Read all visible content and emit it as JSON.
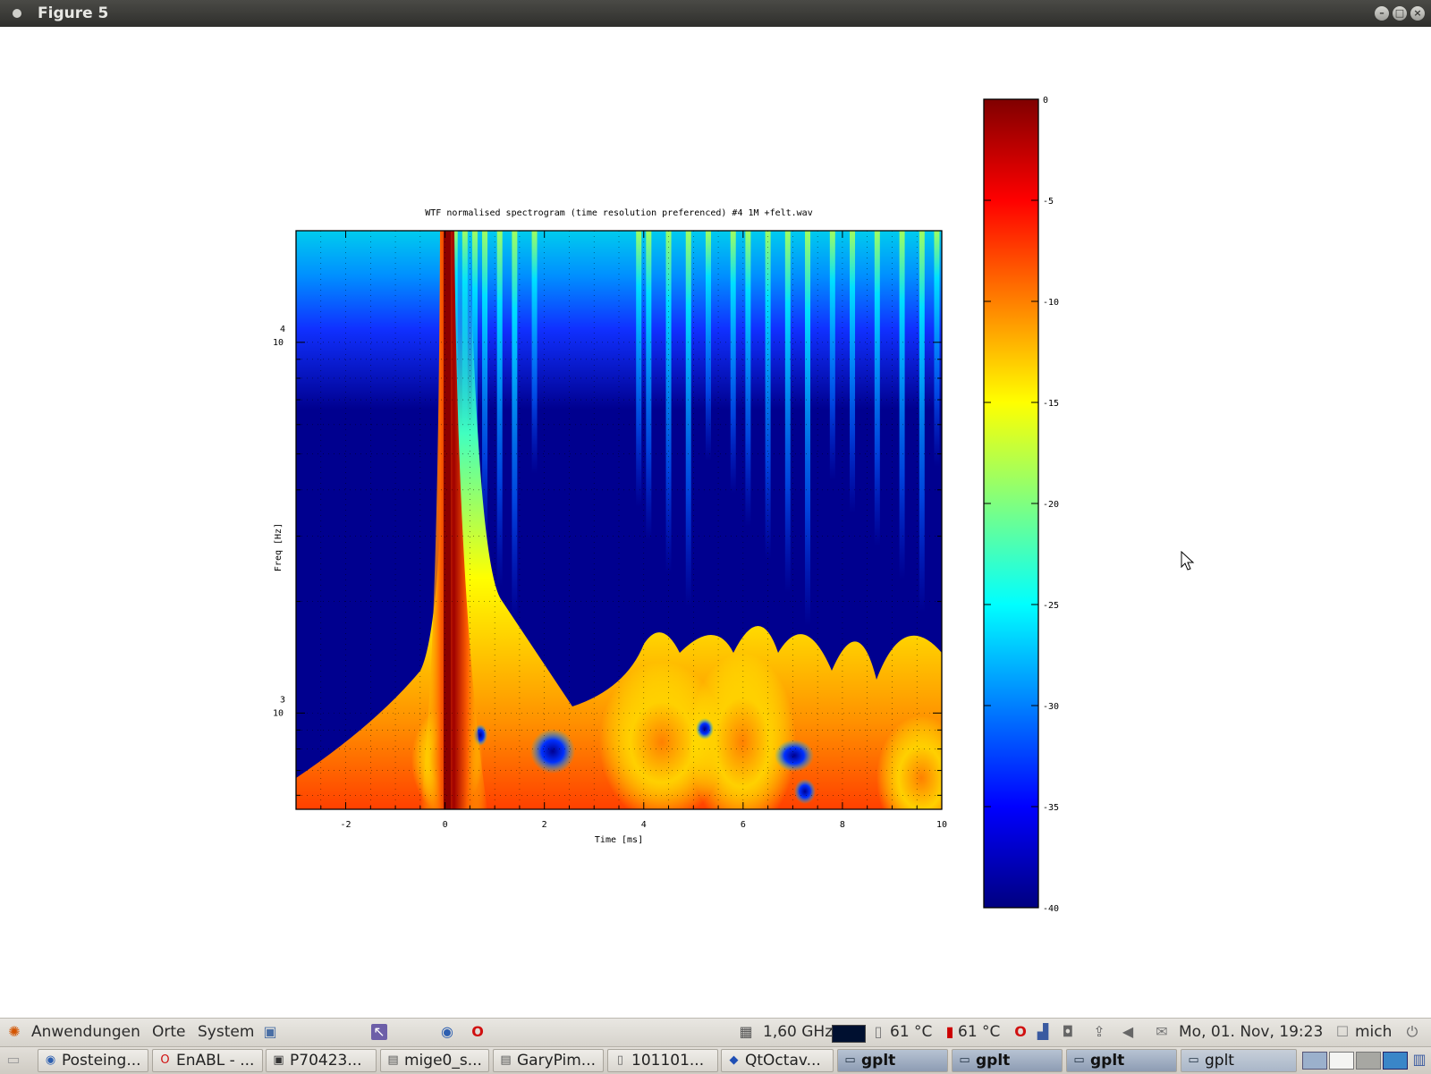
{
  "window": {
    "title": "Figure 5"
  },
  "chart_data": {
    "type": "heatmap",
    "title": "WTF normalised spectrogram (time resolution preferenced)  #4 1M +felt.wav",
    "xlabel": "Time [ms]",
    "ylabel": "Freq [Hz]",
    "xlim": [
      -3,
      10
    ],
    "x_ticks": [
      "-2",
      "0",
      "2",
      "4",
      "6",
      "8",
      "10"
    ],
    "x_tick_values": [
      -2,
      0,
      2,
      4,
      6,
      8,
      10
    ],
    "yscale": "log",
    "y_ticks": [
      {
        "base": "10",
        "exp": "3",
        "value": 1000
      },
      {
        "base": "10",
        "exp": "4",
        "value": 10000
      }
    ],
    "ylim_hz": [
      550,
      20000
    ],
    "grid": true,
    "colormap": "jet",
    "colorbar": {
      "ticks": [
        "0",
        "-5",
        "-10",
        "-15",
        "-20",
        "-25",
        "-30",
        "-35",
        "-40"
      ],
      "range": [
        -40,
        0
      ]
    },
    "features": [
      {
        "desc": "main impulse",
        "time_ms": 0,
        "level": 0
      },
      {
        "desc": "strong low-frequency energy",
        "time_ms": [
          4,
          6.5
        ],
        "level": -12
      },
      {
        "desc": "strong low-frequency energy",
        "time_ms": [
          9,
          10
        ],
        "level": -10
      }
    ],
    "vertical_streaks_ms": [
      0.2,
      0.4,
      0.6,
      0.8,
      1.1,
      1.4,
      1.8,
      3.9,
      4.1,
      4.5,
      4.9,
      5.3,
      5.8,
      6.1,
      6.5,
      6.9,
      7.3,
      7.8,
      8.2,
      8.7,
      9.2,
      9.6,
      9.9
    ]
  },
  "panel_top": {
    "applications": "Anwendungen",
    "places": "Orte",
    "system": "System",
    "cpu_freq": "1,60 GHz",
    "temp1": "61 °C",
    "temp2": "61 °C",
    "clock": "Mo, 01. Nov, 19:23",
    "user": "mich"
  },
  "taskbar": [
    {
      "label": "Posteing...",
      "icon": "thunderbird-icon"
    },
    {
      "label": "EnABL - ...",
      "icon": "opera-icon"
    },
    {
      "label": "P70423...",
      "icon": "image-icon"
    },
    {
      "label": "mige0_s...",
      "icon": "document-icon"
    },
    {
      "label": "GaryPim...",
      "icon": "document-icon"
    },
    {
      "label": "101101...",
      "icon": "text-file-icon"
    },
    {
      "label": "QtOctav...",
      "icon": "octave-icon"
    },
    {
      "label": "gplt",
      "icon": "window-icon"
    },
    {
      "label": "gplt",
      "icon": "window-icon"
    },
    {
      "label": "gplt",
      "icon": "window-icon"
    },
    {
      "label": "gplt",
      "icon": "window-icon"
    }
  ]
}
